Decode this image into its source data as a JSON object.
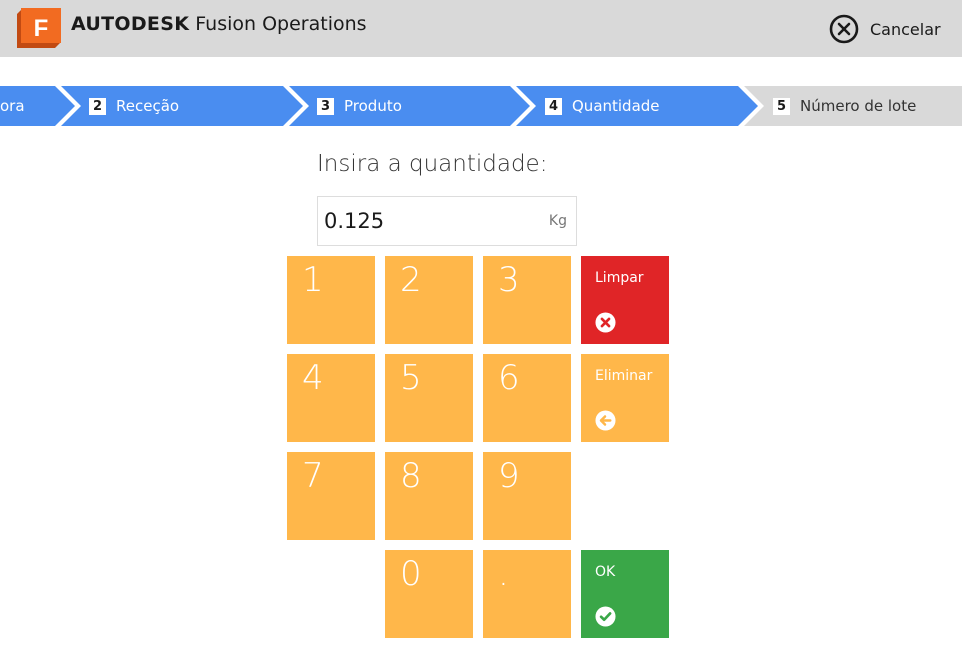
{
  "header": {
    "brand_bold": "AUTODESK",
    "brand_product": "Fusion Operations",
    "logo_letter": "F",
    "cancel_label": "Cancelar"
  },
  "steps": [
    {
      "number": "",
      "label": "ora",
      "state": "done"
    },
    {
      "number": "2",
      "label": "Receção",
      "state": "done"
    },
    {
      "number": "3",
      "label": "Produto",
      "state": "done"
    },
    {
      "number": "4",
      "label": "Quantidade",
      "state": "current"
    },
    {
      "number": "5",
      "label": "Número de lote",
      "state": "pending"
    }
  ],
  "prompt": "Insira a quantidade:",
  "quantity": {
    "value": "0.125",
    "unit": "Kg"
  },
  "keypad": {
    "digits": [
      "1",
      "2",
      "3",
      "4",
      "5",
      "6",
      "7",
      "8",
      "9",
      "0",
      "."
    ],
    "clear_label": "Limpar",
    "delete_label": "Eliminar",
    "ok_label": "OK"
  },
  "colors": {
    "header_bg": "#d9d9d9",
    "step_active": "#4a8df0",
    "step_pending": "#d9d9d9",
    "key": "#ffb74a",
    "clear": "#e02527",
    "ok": "#3aa748",
    "logo": "#f26b21"
  },
  "icons": {
    "cancel": "circle-x-icon",
    "clear": "circle-x-icon",
    "delete": "circle-arrow-left-icon",
    "ok": "circle-check-icon"
  }
}
